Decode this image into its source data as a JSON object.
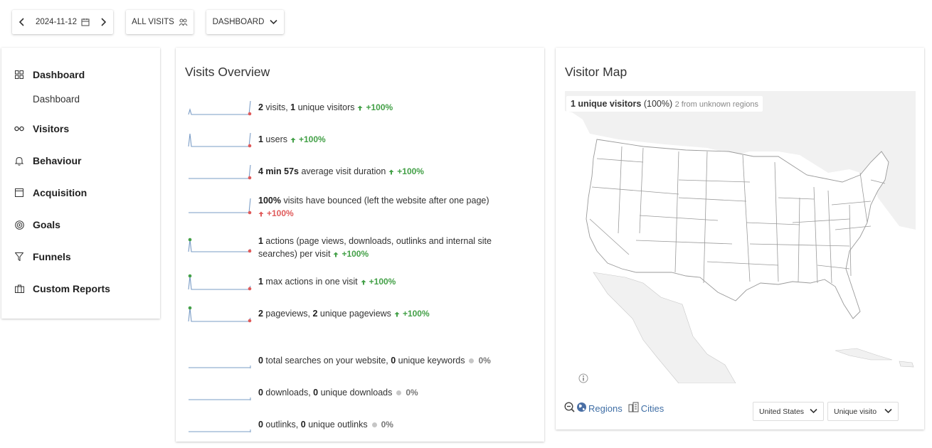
{
  "toolbar": {
    "date": "2024-11-12",
    "segment_label": "ALL VISITS",
    "dashboard_label": "DASHBOARD"
  },
  "sidebar": {
    "items": [
      {
        "label": "Dashboard",
        "icon": "grid-icon"
      },
      {
        "label": "Visitors",
        "icon": "glasses-icon"
      },
      {
        "label": "Behaviour",
        "icon": "bell-icon"
      },
      {
        "label": "Acquisition",
        "icon": "browser-window-icon"
      },
      {
        "label": "Goals",
        "icon": "target-icon"
      },
      {
        "label": "Funnels",
        "icon": "funnel-icon"
      },
      {
        "label": "Custom Reports",
        "icon": "briefcase-icon"
      }
    ],
    "sub_dashboard": "Dashboard"
  },
  "visits_overview": {
    "title": "Visits Overview",
    "rows": [
      {
        "v1": "2",
        "t1": " visits, ",
        "v2": "1",
        "t2": " unique visitors",
        "trend": "+100%",
        "trend_kind": "up"
      },
      {
        "v1": "1",
        "t1": " users",
        "trend": "+100%",
        "trend_kind": "up"
      },
      {
        "v1": "4 min 57s",
        "t1": " average visit duration",
        "trend": "+100%",
        "trend_kind": "up"
      },
      {
        "v1": "100%",
        "t1": " visits have bounced (left the website after one page)",
        "trend": "+100%",
        "trend_kind": "bad"
      },
      {
        "v1": "1",
        "t1": " actions (page views, downloads, outlinks and internal site searches) per visit",
        "trend": "+100%",
        "trend_kind": "up"
      },
      {
        "v1": "1",
        "t1": " max actions in one visit",
        "trend": "+100%",
        "trend_kind": "up"
      },
      {
        "v1": "2",
        "t1": " pageviews, ",
        "v2": "2",
        "t2": " unique pageviews",
        "trend": "+100%",
        "trend_kind": "up"
      },
      {
        "v1": "0",
        "t1": " total searches on your website, ",
        "v2": "0",
        "t2": " unique keywords",
        "trend": "0%",
        "trend_kind": "flat"
      },
      {
        "v1": "0",
        "t1": " downloads, ",
        "v2": "0",
        "t2": " unique downloads",
        "trend": "0%",
        "trend_kind": "flat"
      },
      {
        "v1": "0",
        "t1": " outlinks, ",
        "v2": "0",
        "t2": " unique outlinks",
        "trend": "0%",
        "trend_kind": "flat"
      }
    ]
  },
  "visitor_map": {
    "title": "Visitor Map",
    "summary_bold": "1 unique visitors",
    "summary_pct": "(100%)",
    "summary_note": "2 from unknown regions",
    "regions_label": "Regions",
    "cities_label": "Cities",
    "country_select": "United States",
    "metric_select": "Unique visito"
  },
  "colors": {
    "trend_up": "#43a047",
    "trend_bad": "#e05a5a",
    "spark_line": "#7a9cc6",
    "spark_end": "#e05a5a",
    "spark_start": "#43a047",
    "map_land": "#f1f1f1",
    "map_border": "#9a9a9a"
  }
}
